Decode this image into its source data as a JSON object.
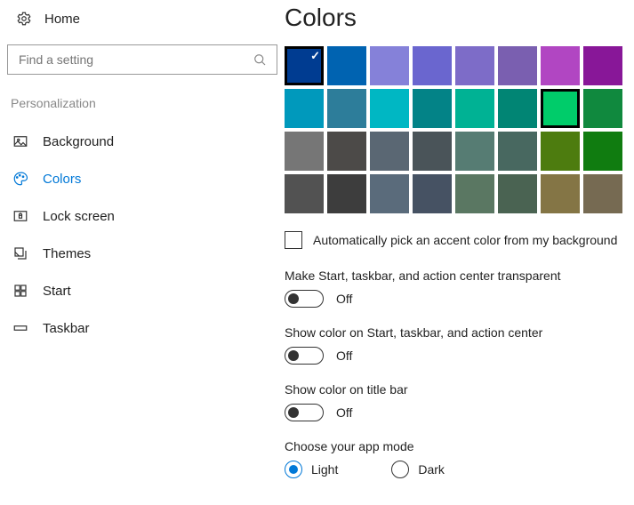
{
  "home_label": "Home",
  "search_placeholder": "Find a setting",
  "group_title": "Personalization",
  "nav": {
    "background": "Background",
    "colors": "Colors",
    "lock_screen": "Lock screen",
    "themes": "Themes",
    "start": "Start",
    "taskbar": "Taskbar"
  },
  "page_title": "Colors",
  "swatch_colors": [
    "#003c91",
    "#0063b1",
    "#8581d9",
    "#6a66cf",
    "#7d6cc8",
    "#7a5fb0",
    "#b146c2",
    "#881798",
    "#0099bc",
    "#2d7d9a",
    "#00b7c3",
    "#038387",
    "#00b294",
    "#018574",
    "#00cc6a",
    "#10893e",
    "#767676",
    "#4c4a48",
    "#5a6773",
    "#4a5459",
    "#567c73",
    "#486860",
    "#4d7c0f",
    "#107c10",
    "#525252",
    "#3d3d3d",
    "#5a6b7b",
    "#465263",
    "#5a7762",
    "#4a6352",
    "#847545",
    "#766a52"
  ],
  "selected_swatch_index": 0,
  "highlighted_swatch_index": 14,
  "auto_pick_label": "Automatically pick an accent color from my background",
  "settings": {
    "transparent": {
      "label": "Make Start, taskbar, and action center transparent",
      "state": "Off"
    },
    "show_color_start": {
      "label": "Show color on Start, taskbar, and action center",
      "state": "Off"
    },
    "show_color_title": {
      "label": "Show color on title bar",
      "state": "Off"
    }
  },
  "app_mode_label": "Choose your app mode",
  "app_mode": {
    "light": "Light",
    "dark": "Dark",
    "selected": "light"
  }
}
